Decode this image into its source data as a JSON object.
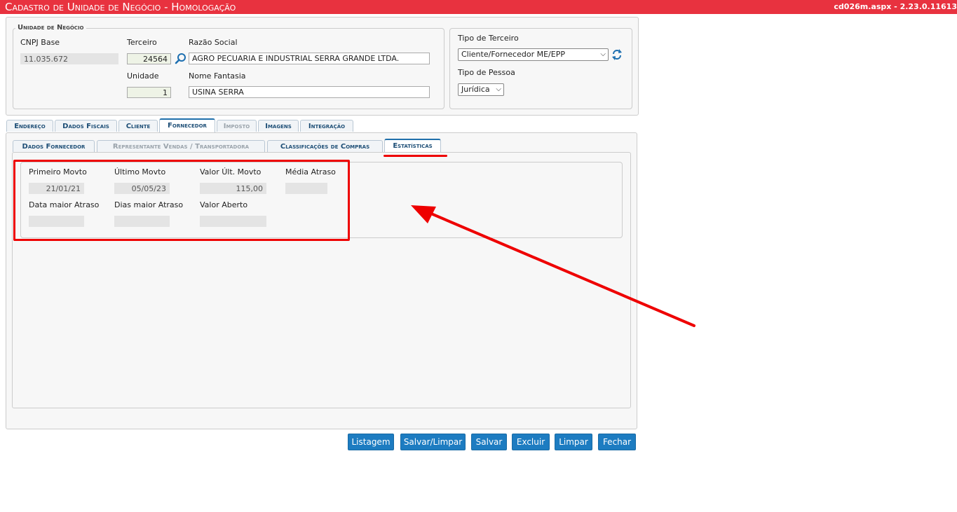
{
  "header": {
    "title": "Cadastro de Unidade de Negócio  - Homologação",
    "version": "cd026m.aspx - 2.23.0.11613"
  },
  "unidade": {
    "legend": "Unidade de Negócio",
    "cnpj_label": "CNPJ Base",
    "cnpj_value": "11.035.672",
    "terceiro_label": "Terceiro",
    "terceiro_value": "24564",
    "razao_label": "Razão Social",
    "razao_value": "AGRO PECUARIA E INDUSTRIAL SERRA GRANDE LTDA.",
    "unidade_label": "Unidade",
    "unidade_value": "1",
    "fantasia_label": "Nome Fantasia",
    "fantasia_value": "USINA SERRA"
  },
  "tipos": {
    "tipo_terceiro_label": "Tipo de Terceiro",
    "tipo_terceiro_value": "Cliente/Fornecedor ME/EPP",
    "tipo_pessoa_label": "Tipo de Pessoa",
    "tipo_pessoa_value": "Jurídica"
  },
  "tabs": [
    "Endereço",
    "Dados Fiscais",
    "Cliente",
    "Fornecedor",
    "Imposto",
    "Imagens",
    "Integração"
  ],
  "subtabs": [
    "Dados Fornecedor",
    "Representante Vendas / Transportadora",
    "Classificações de Compras",
    "Estatísticas"
  ],
  "stats": {
    "primeiro_label": "Primeiro Movto",
    "primeiro_value": "21/01/21",
    "ultimo_label": "Último Movto",
    "ultimo_value": "05/05/23",
    "valor_ult_label": "Valor Últ. Movto",
    "valor_ult_value": "115,00",
    "media_label": "Média Atraso",
    "media_value": "",
    "data_maior_label": "Data maior Atraso",
    "data_maior_value": "",
    "dias_maior_label": "Dias maior Atraso",
    "dias_maior_value": "",
    "valor_aberto_label": "Valor Aberto",
    "valor_aberto_value": ""
  },
  "buttons": [
    "Listagem",
    "Salvar/Limpar",
    "Salvar",
    "Excluir",
    "Limpar",
    "Fechar"
  ],
  "colors": {
    "title_bar": "#e8323f",
    "button": "#1d7cc1",
    "annotation": "#ee0000"
  },
  "icons": {
    "lookup": "magnifier-icon",
    "refresh": "refresh-icon",
    "annotation": "red-arrow"
  }
}
